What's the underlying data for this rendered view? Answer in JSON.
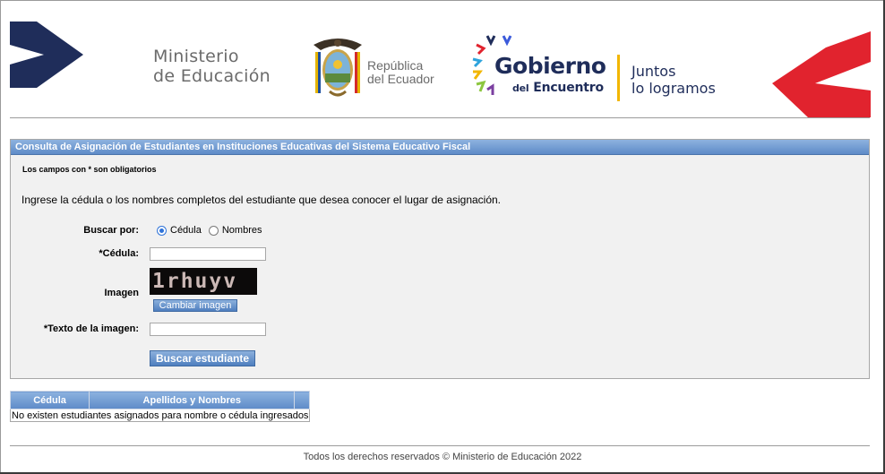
{
  "header": {
    "ministerio_line1": "Ministerio",
    "ministerio_line2": "de Educación",
    "republica_line1": "República",
    "republica_line2": "del Ecuador",
    "gobierno": "Gobierno",
    "encuentro_prefix": "del",
    "encuentro": "Encuentro",
    "juntos_line1": "Juntos",
    "juntos_line2": "lo logramos",
    "colors": {
      "navy": "#1f2d5a",
      "red": "#e1232e",
      "gold": "#f2b600"
    }
  },
  "form": {
    "title": "Consulta de Asignación de Estudiantes en Instituciones Educativas del Sistema Educativo Fiscal",
    "required_note": "Los campos con * son obligatorios",
    "instruction": "Ingrese la cédula o los nombres completos del estudiante que desea conocer el lugar de asignación.",
    "search_by_label": "Buscar por:",
    "radio_options": [
      {
        "label": "Cédula",
        "selected": true
      },
      {
        "label": "Nombres",
        "selected": false
      }
    ],
    "cedula_label": "*Cédula:",
    "cedula_value": "",
    "image_label": "Imagen",
    "captcha_text": "1rhuyv",
    "change_image_button": "Cambiar imagen",
    "image_text_label": "*Texto de la imagen:",
    "image_text_value": "",
    "search_button": "Buscar estudiante"
  },
  "results": {
    "columns": [
      "Cédula",
      "Apellidos y Nombres",
      ""
    ],
    "empty_message": "No existen estudiantes asignados para nombre o cédula ingresados"
  },
  "footer": {
    "text": "Todos los derechos reservados © Ministerio de Educación 2022"
  }
}
